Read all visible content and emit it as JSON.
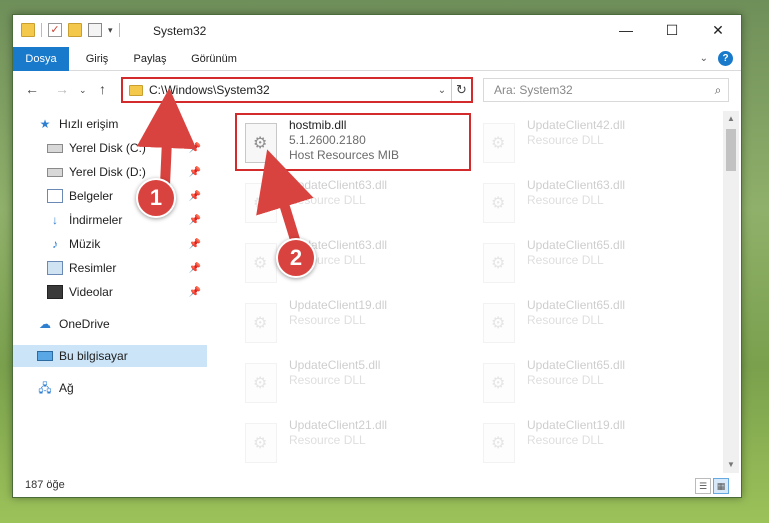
{
  "window": {
    "title": "System32"
  },
  "ribbon": {
    "tabs": [
      "Dosya",
      "Giriş",
      "Paylaş",
      "Görünüm"
    ]
  },
  "navigation": {
    "address_path": "C:\\Windows\\System32",
    "search_placeholder": "Ara: System32"
  },
  "sidebar": {
    "quick_access_label": "Hızlı erişim",
    "items": [
      {
        "label": "Yerel Disk (C:)",
        "icon": "disk-icon",
        "pinned": true
      },
      {
        "label": "Yerel Disk (D:)",
        "icon": "disk-icon",
        "pinned": true
      },
      {
        "label": "Belgeler",
        "icon": "documents-icon",
        "pinned": true
      },
      {
        "label": "İndirmeler",
        "icon": "download-icon",
        "pinned": true
      },
      {
        "label": "Müzik",
        "icon": "music-icon",
        "pinned": true
      },
      {
        "label": "Resimler",
        "icon": "pictures-icon",
        "pinned": true
      },
      {
        "label": "Videolar",
        "icon": "videos-icon",
        "pinned": true
      }
    ],
    "onedrive_label": "OneDrive",
    "this_pc_label": "Bu bilgisayar",
    "network_label": "Ağ"
  },
  "files": {
    "highlighted": {
      "name": "hostmib.dll",
      "version": "5.1.2600.2180",
      "description": "Host Resources MIB"
    },
    "faded_left": [
      {
        "name": "UpdateClient63.dll",
        "description": "Resource DLL"
      },
      {
        "name": "UpdateClient63.dll",
        "description": "Resource DLL"
      },
      {
        "name": "UpdateClient19.dll",
        "description": "Resource DLL"
      },
      {
        "name": "UpdateClient5.dll",
        "description": "Resource DLL"
      },
      {
        "name": "UpdateClient21.dll",
        "description": "Resource DLL"
      }
    ],
    "faded_right": [
      {
        "name": "UpdateClient42.dll",
        "description": "Resource DLL"
      },
      {
        "name": "UpdateClient63.dll",
        "description": "Resource DLL"
      },
      {
        "name": "UpdateClient65.dll",
        "description": "Resource DLL"
      },
      {
        "name": "UpdateClient65.dll",
        "description": "Resource DLL"
      },
      {
        "name": "UpdateClient65.dll",
        "description": "Resource DLL"
      },
      {
        "name": "UpdateClient19.dll",
        "description": "Resource DLL"
      }
    ]
  },
  "status": {
    "item_count": "187 öğe"
  },
  "annotations": {
    "step1": "1",
    "step2": "2",
    "color": "#d9433f"
  }
}
